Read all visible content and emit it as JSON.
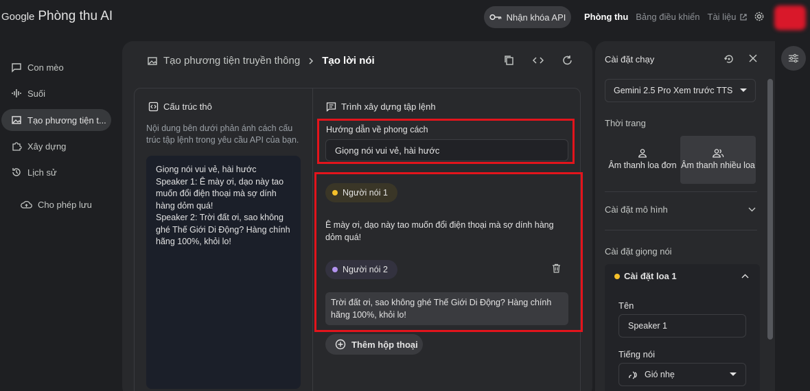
{
  "header": {
    "brand_google": "Google",
    "brand_product": "Phòng thu AI",
    "api_button": "Nhận khóa API",
    "nav": {
      "studio": "Phòng thu",
      "dashboard": "Bảng điều khiển",
      "docs": "Tài liệu"
    }
  },
  "sidebar": {
    "items": [
      {
        "label": "Con mèo",
        "icon": "chat-icon"
      },
      {
        "label": "Suối",
        "icon": "waveform-icon"
      },
      {
        "label": "Tạo phương tiện t...",
        "icon": "media-icon",
        "active": true
      },
      {
        "label": "Xây dựng",
        "icon": "puzzle-icon"
      },
      {
        "label": "Lịch sử",
        "icon": "history-icon"
      }
    ],
    "save_label": "Cho phép lưu"
  },
  "main": {
    "breadcrumb_parent": "Tạo phương tiện truyền thông",
    "breadcrumb_current": "Tạo lời nói",
    "raw_structure": {
      "title": "Cấu trúc thô",
      "description": "Nội dung bên dưới phản ánh cách cấu trúc tập lệnh trong yêu cầu API của bạn.",
      "lines": [
        "Giọng nói vui vẻ, hài hước",
        "Speaker 1: Ê mày ơi, dạo này tao muốn đổi điện thoại mà sợ dính hàng dỏm quá!",
        "Speaker 2: Trời đất ơi, sao không ghé Thế Giới Di Động? Hàng chính hãng 100%, khỏi lo!"
      ]
    },
    "script_builder": {
      "title": "Trình xây dựng tập lệnh",
      "style_label": "Hướng dẫn về phong cách",
      "style_value": "Giọng nói vui vẻ, hài hước",
      "speakers": [
        {
          "name": "Người nói 1",
          "color": "#f5c02a",
          "text": "Ê mày ơi, dạo này tao muốn đổi điện thoại mà sợ dính hàng dỏm quá!"
        },
        {
          "name": "Người nói 2",
          "color": "#b393f0",
          "text": "Trời đất ơi, sao không ghé Thế Giới Di Động? Hàng chính hãng 100%, khỏi lo!"
        }
      ],
      "add_button": "Thêm hộp thoại"
    }
  },
  "run_settings": {
    "title": "Cài đặt chạy",
    "model": "Gemini 2.5 Pro Xem trước TTS",
    "mode_label": "Thời trang",
    "modes": {
      "single": "Âm thanh loa đơn",
      "multi": "Âm thanh nhiều loa"
    },
    "model_settings": "Cài đặt mô hình",
    "voice_settings": "Cài đặt giọng nói",
    "speaker_settings": {
      "title": "Cài đặt loa 1",
      "dot_color": "#f5c02a",
      "name_label": "Tên",
      "name_value": "Speaker 1",
      "voice_label": "Tiếng nói",
      "voice_value": "Gió nhẹ"
    }
  }
}
